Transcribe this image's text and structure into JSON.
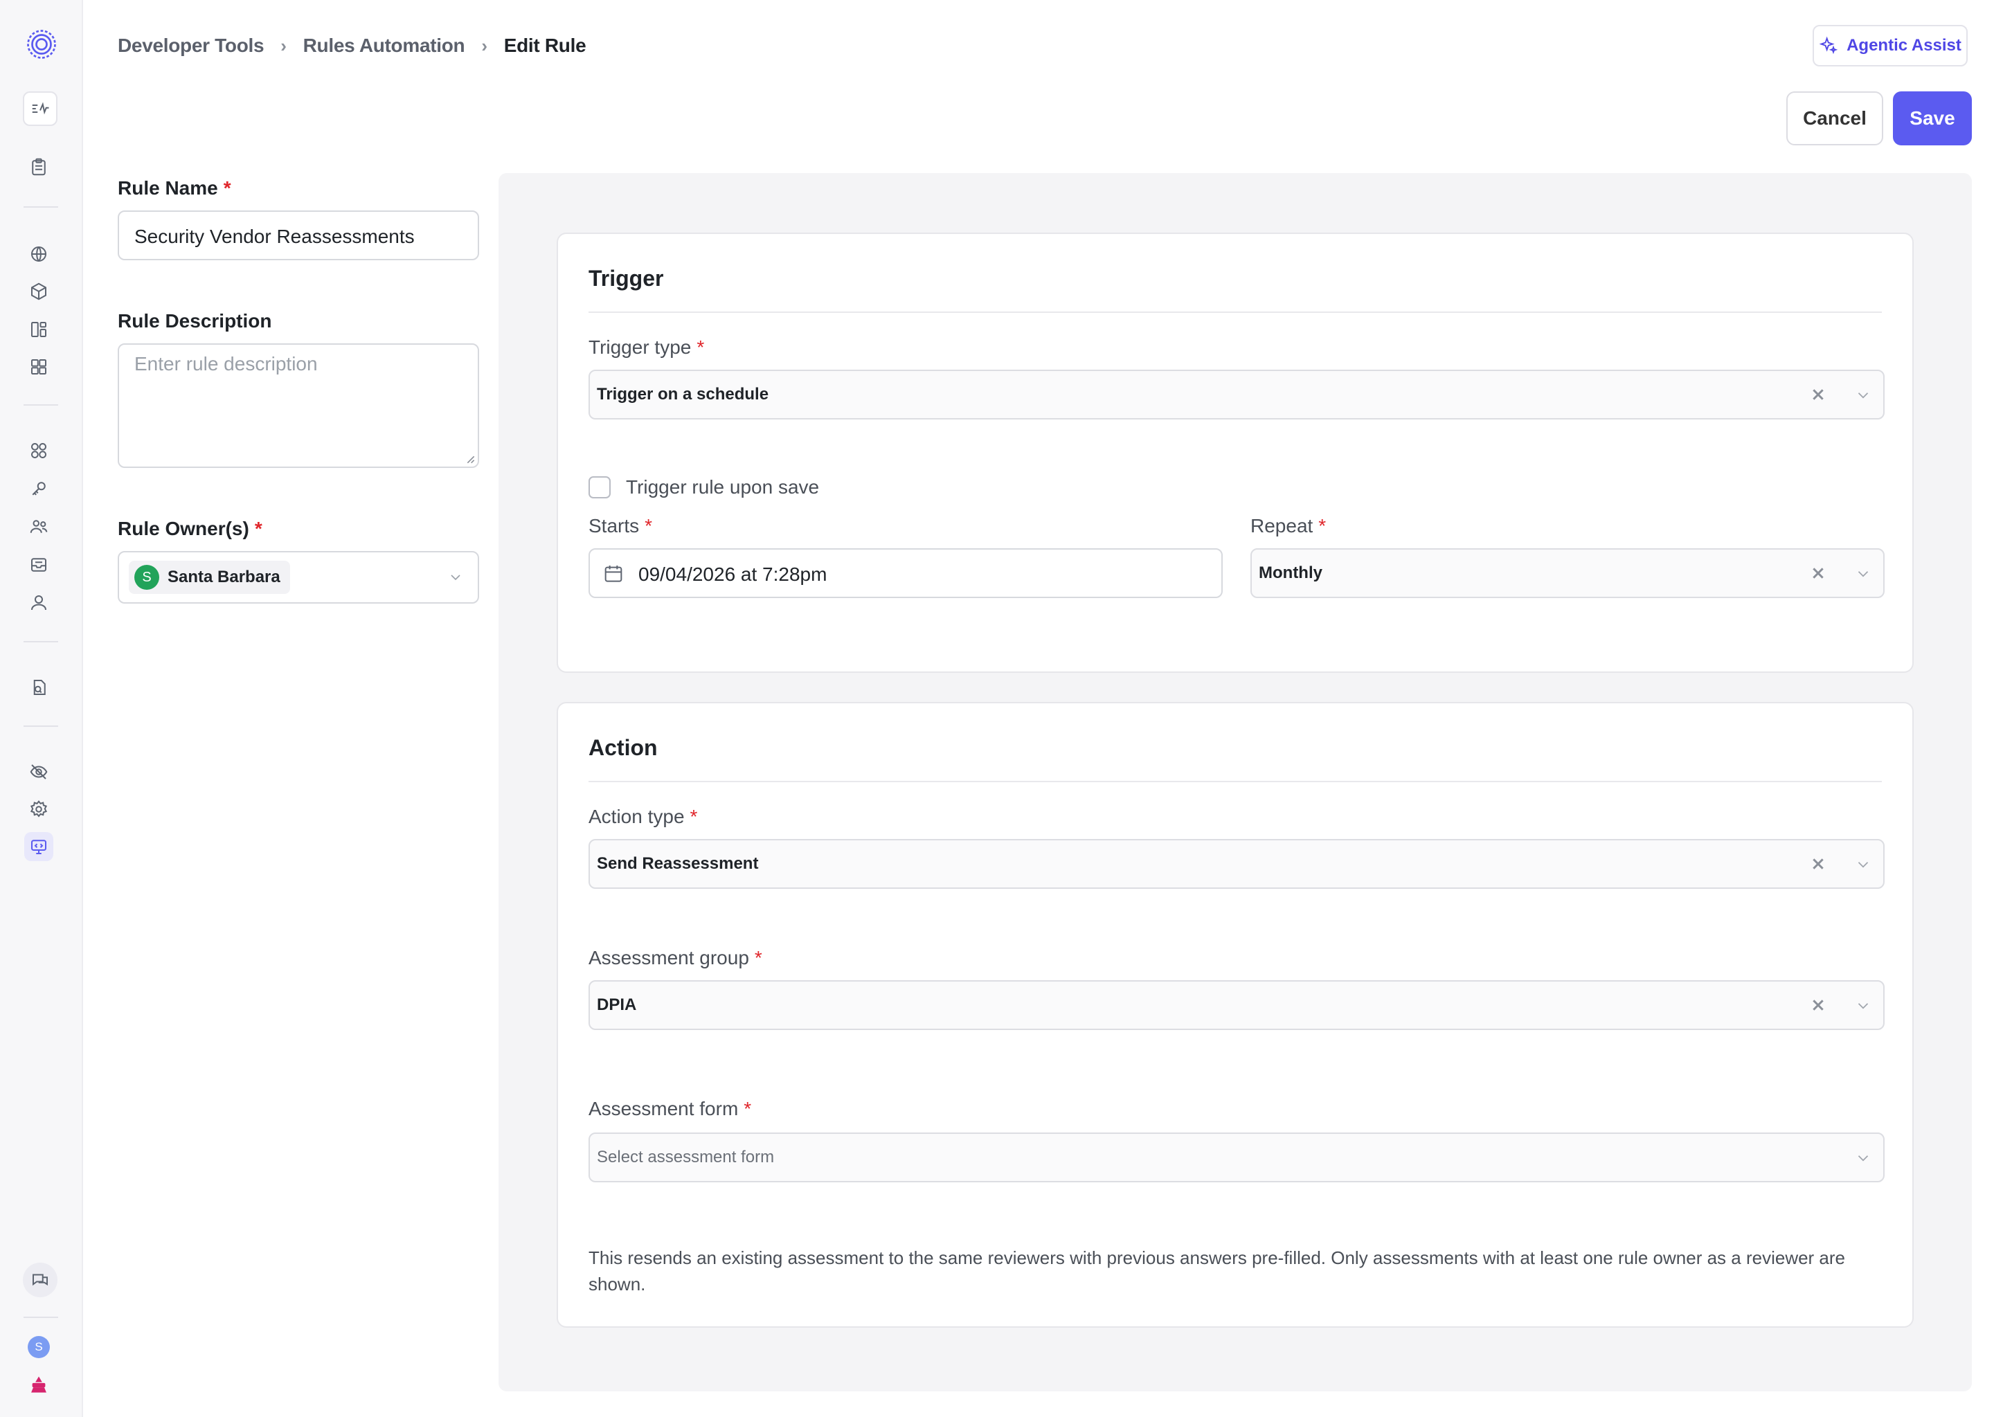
{
  "breadcrumb": {
    "items": [
      "Developer Tools",
      "Rules Automation"
    ],
    "current": "Edit Rule"
  },
  "header": {
    "assist_label": "Agentic Assist",
    "cancel_label": "Cancel",
    "save_label": "Save"
  },
  "form": {
    "rule_name_label": "Rule Name",
    "rule_name_value": "Security Vendor Reassessments",
    "rule_description_label": "Rule Description",
    "rule_description_placeholder": "Enter rule description",
    "rule_owners_label": "Rule Owner(s)",
    "owner": {
      "initial": "S",
      "name": "Santa Barbara"
    },
    "required_mark": "*"
  },
  "trigger": {
    "title": "Trigger",
    "type_label": "Trigger type",
    "type_value": "Trigger on a schedule",
    "upon_save_label": "Trigger rule upon save",
    "upon_save_checked": false,
    "starts_label": "Starts",
    "starts_value": "09/04/2026 at 7:28pm",
    "repeat_label": "Repeat",
    "repeat_value": "Monthly"
  },
  "action": {
    "title": "Action",
    "type_label": "Action type",
    "type_value": "Send Reassessment",
    "group_label": "Assessment group",
    "group_value": "DPIA",
    "form_label": "Assessment form",
    "form_placeholder": "Select assessment form",
    "note": "This resends an existing assessment to the same reviewers with previous answers pre-filled. Only assessments with at least one rule owner as a reviewer are shown."
  },
  "user": {
    "avatar_initial": "S"
  },
  "colors": {
    "accent": "#5b5bf0",
    "required": "#e0262b",
    "owner_avatar": "#22a35a",
    "user_avatar": "#7b9cf2",
    "help_icon": "#d6246e"
  }
}
